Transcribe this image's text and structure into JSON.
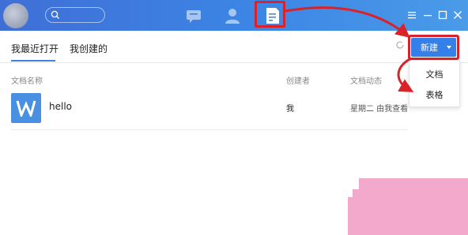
{
  "search": {
    "placeholder": ""
  },
  "nav": {
    "chat_icon": "chat-icon",
    "user_icon": "user-icon",
    "doc_icon": "document-icon"
  },
  "window_controls": [
    "menu-icon",
    "minimize-icon",
    "maximize-icon",
    "close-icon"
  ],
  "tabs": [
    {
      "label": "我最近打开"
    },
    {
      "label": "我创建的"
    }
  ],
  "new_button": {
    "label": "新建"
  },
  "new_menu": [
    {
      "label": "文档"
    },
    {
      "label": "表格"
    }
  ],
  "table": {
    "headers": [
      "文档名称",
      "创建者",
      "文档动态"
    ],
    "rows": [
      {
        "name": "hello",
        "creator": "我",
        "activity": "星期二 由我查看"
      }
    ]
  },
  "colors": {
    "topbar": "#3c86e6",
    "accent": "#3480e8",
    "highlight": "#d9222a"
  }
}
